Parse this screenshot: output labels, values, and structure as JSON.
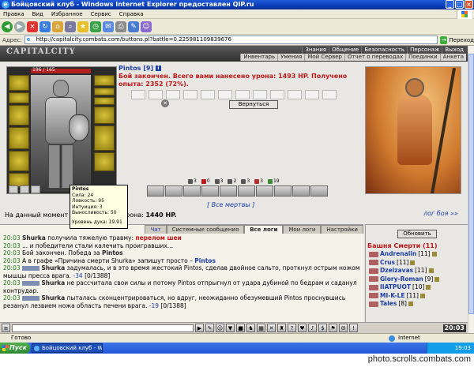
{
  "window": {
    "title": "Бойцовский клуб - Windows Internet Explorer предоставлен QIP.ru"
  },
  "menu": [
    "Правка",
    "Вид",
    "Избранное",
    "Сервис",
    "Справка"
  ],
  "address": {
    "label": "Адрес:",
    "url": "http://capitalcity.combats.com/buttons.pl?battle=0.225981109839676",
    "go_label": "Переход"
  },
  "game": {
    "logo": "CAPITALCITY",
    "top_nav": [
      "Знания",
      "Общение",
      "Безопасность",
      "Персонаж",
      "Выход"
    ],
    "sub_nav": [
      "Инвентарь",
      "Умения",
      "Мой Сервер",
      "Отчет о переводах",
      "Поединки",
      "Анкета"
    ]
  },
  "character": {
    "hp": "196 / 165",
    "hp_fraction": 1.0,
    "tooltip": {
      "name": "Pintos",
      "lines": [
        "Сила: 24",
        "Ловкость: 95",
        "Интуиция: 3",
        "Выносливость: 50"
      ],
      "spirit": "Уровень духа: 19.91"
    }
  },
  "battle": {
    "player_name": "Pintos",
    "player_level": "[9]",
    "message": "Бой закончен. Всего вами нанесено урона: 1493 HP. Получено опыта: 2352 (72%).",
    "return_button": "Вернуться",
    "effects": [
      "3",
      "0",
      "3",
      "2",
      "3",
      "3",
      "19"
    ],
    "all_dead": "[ Все мертвы ]",
    "log_link": "лог боя »»",
    "damage_label": "На данный момент вами нанесено урона:",
    "damage_value": "1440 HP."
  },
  "chat": {
    "tabs": [
      "Чат",
      "Системные сообщения",
      "Все логи",
      "Мои логи",
      "Настройки"
    ],
    "lines": [
      {
        "time": "20:03",
        "who": "Shurka",
        "pre": "получила тяжелую травму:",
        "hl": "перелом шеи",
        "post": ""
      },
      {
        "time": "20:03",
        "who": "",
        "pre": "... и победители стали калечить проигравших...",
        "hl": "",
        "post": ""
      },
      {
        "time": "20:03",
        "who": "",
        "pre": "Бой закончен. Победа за",
        "hl": "Pintos",
        "post": ""
      },
      {
        "time": "20:03",
        "who": "",
        "pre": "А в графе «Причина смерти Shurka» запишут просто –",
        "hl": "Pintos",
        "post": ""
      },
      {
        "time": "20:03",
        "who": "Shurka",
        "pre": "задумалась, и в это время жестокий Pintos, сделав двойное сальто, проткнул острым ножом мышцы пресса врага.",
        "hl": "-34",
        "post": "[0/1388]"
      },
      {
        "time": "20:03",
        "who": "Shurka",
        "pre": "не рассчитала свои силы и потому Pintos отпрыгнул от удара дубиной по бедрам и саданул контрудар.",
        "hl": "",
        "post": ""
      },
      {
        "time": "20:03",
        "who": "Shurka",
        "pre": "пыталась сконцентрироваться, но вдруг, неожиданно обезумевший Pintos проснувшись резанул лезвием ножа область печени врага.",
        "hl": "-19",
        "post": "[0/1388]"
      }
    ]
  },
  "right_panel": {
    "refresh_label": "Обновить",
    "tower_title": "Башня Смерти (11)",
    "players": [
      {
        "name": "Andrenalin",
        "level": "[11]"
      },
      {
        "name": "Crus",
        "level": "[11]"
      },
      {
        "name": "Dzelzavas",
        "level": "[11]"
      },
      {
        "name": "Glory-Roman",
        "level": "[9]"
      },
      {
        "name": "IIATPUOT",
        "level": "[10]"
      },
      {
        "name": "MI-K-LE",
        "level": "[11]"
      },
      {
        "name": "Tales",
        "level": "[8]"
      }
    ]
  },
  "game_clock": "20:03",
  "statusbar": {
    "left": "Готово",
    "zone": "Internet"
  },
  "taskbar": {
    "start": "Пуск",
    "task": "Бойцовский клуб - Wi...",
    "time": "19:03"
  },
  "watermark": "photo.scrolls.combats.com"
}
